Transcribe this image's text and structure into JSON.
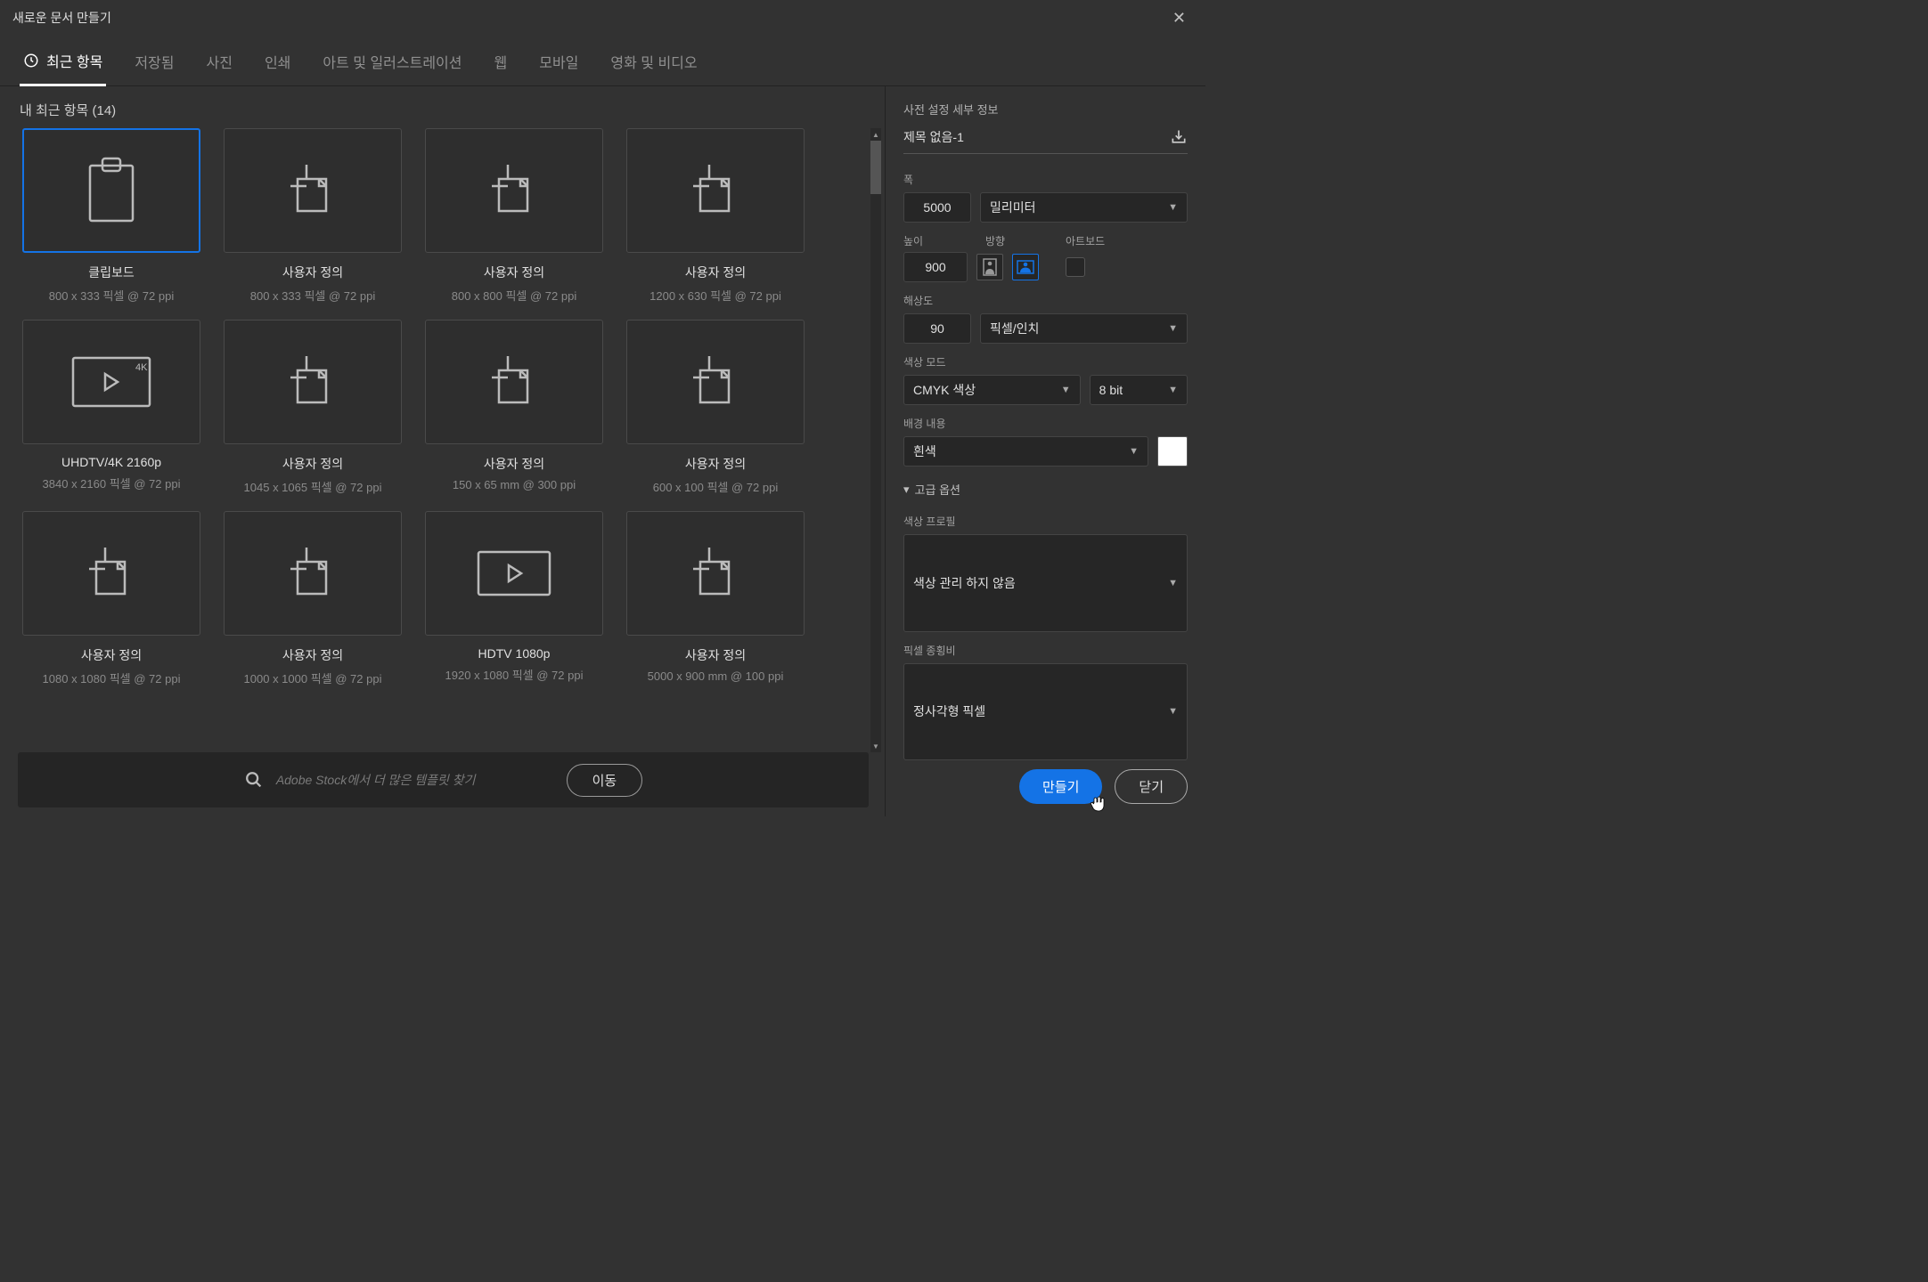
{
  "title": "새로운 문서 만들기",
  "tabs": [
    "최근 항목",
    "저장됨",
    "사진",
    "인쇄",
    "아트 및 일러스트레이션",
    "웹",
    "모바일",
    "영화 및 비디오"
  ],
  "recent_label": "내 최근 항목  (14)",
  "presets": [
    {
      "title": "클립보드",
      "sub": "800 x 333 픽셀 @ 72 ppi",
      "icon": "clipboard",
      "selected": true
    },
    {
      "title": "사용자 정의",
      "sub": "800 x 333 픽셀 @ 72 ppi",
      "icon": "doc"
    },
    {
      "title": "사용자 정의",
      "sub": "800 x 800 픽셀 @ 72 ppi",
      "icon": "doc"
    },
    {
      "title": "사용자 정의",
      "sub": "1200 x 630 픽셀 @ 72 ppi",
      "icon": "doc"
    },
    {
      "title": "UHDTV/4K 2160p",
      "sub": "3840 x 2160 픽셀 @ 72 ppi",
      "icon": "video4k"
    },
    {
      "title": "사용자 정의",
      "sub": "1045 x 1065 픽셀 @ 72 ppi",
      "icon": "doc"
    },
    {
      "title": "사용자 정의",
      "sub": "150 x 65 mm @ 300 ppi",
      "icon": "doc"
    },
    {
      "title": "사용자 정의",
      "sub": "600 x 100 픽셀 @ 72 ppi",
      "icon": "doc"
    },
    {
      "title": "사용자 정의",
      "sub": "1080 x 1080 픽셀 @ 72 ppi",
      "icon": "doc"
    },
    {
      "title": "사용자 정의",
      "sub": "1000 x 1000 픽셀 @ 72 ppi",
      "icon": "doc"
    },
    {
      "title": "HDTV 1080p",
      "sub": "1920 x 1080 픽셀 @ 72 ppi",
      "icon": "video"
    },
    {
      "title": "사용자 정의",
      "sub": "5000 x 900 mm @ 100 ppi",
      "icon": "doc"
    }
  ],
  "stock": {
    "placeholder": "Adobe Stock에서 더 많은 템플릿 찾기",
    "go": "이동"
  },
  "details": {
    "heading": "사전 설정 세부 정보",
    "name": "제목 없음-1",
    "width_label": "폭",
    "width_value": "5000",
    "unit": "밀리미터",
    "height_label": "높이",
    "orient_label": "방향",
    "artboard_label": "아트보드",
    "height_value": "900",
    "resolution_label": "해상도",
    "resolution_value": "90",
    "resolution_unit": "픽셀/인치",
    "colormode_label": "색상 모드",
    "colormode_value": "CMYK 색상",
    "bitdepth": "8 bit",
    "bg_label": "배경 내용",
    "bg_value": "흰색",
    "advanced": "고급 옵션",
    "profile_label": "색상 프로필",
    "profile_value": "색상 관리 하지 않음",
    "aspect_label": "픽셀 종횡비",
    "aspect_value": "정사각형 픽셀"
  },
  "buttons": {
    "create": "만들기",
    "close": "닫기"
  }
}
